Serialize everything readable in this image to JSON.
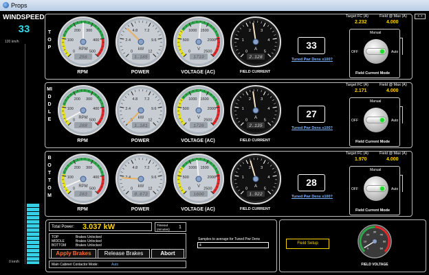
{
  "window": {
    "title": "Props"
  },
  "windspeed": {
    "label": "WINDSPEED",
    "value": "33",
    "scale_max": "120 km/h",
    "scale_min": "0 km/h",
    "bar_fraction": 0.275
  },
  "corner_button": "< >",
  "rows": [
    {
      "name": "TOP",
      "gauges": {
        "rpm": {
          "label": "RPM",
          "unit": "RPM",
          "readout": "256",
          "needle_fraction": 0.5
        },
        "power": {
          "label": "POWER",
          "unit": "kW",
          "readout": "1.185",
          "needle_fraction": 0.33
        },
        "voltage": {
          "label": "VOLTAGE (AC)",
          "unit": "V",
          "readout": "1719",
          "needle_fraction": 0.52
        },
        "current": {
          "label": "FIELD CURRENT",
          "unit": "A",
          "readout": "2.128",
          "needle_fraction": 0.47
        }
      },
      "tuned_value": "33",
      "tuned_label": "Tuned Pwr Dens x100?",
      "target_label": "Target FC (A)",
      "target_value": "2.232",
      "field_label": "Field @ Max (A)",
      "field_value": "4.000",
      "mode": {
        "manual": "Manual",
        "off": "OFF",
        "auto": "Auto",
        "caption": "Field Current Mode"
      }
    },
    {
      "name": "MIDDLE",
      "gauges": {
        "rpm": {
          "label": "RPM",
          "unit": "RPM",
          "readout": "288",
          "needle_fraction": 0.06
        },
        "power": {
          "label": "POWER",
          "unit": "kW",
          "readout": "1.181",
          "needle_fraction": 0.0
        },
        "voltage": {
          "label": "VOLTAGE (AC)",
          "unit": "V",
          "readout": "1726",
          "needle_fraction": 0.52
        },
        "current": {
          "label": "FIELD CURRENT",
          "unit": "A",
          "readout": "2.135",
          "needle_fraction": 0.47
        }
      },
      "tuned_value": "27",
      "tuned_label": "Tuned Pwr Dens x100?",
      "target_label": "Target FC (A)",
      "target_value": "2.171",
      "field_label": "Field @ Max (A)",
      "field_value": "4.000",
      "mode": {
        "manual": "Manual",
        "off": "OFF",
        "auto": "Auto",
        "caption": "Field Current Mode"
      }
    },
    {
      "name": "BOTTOM",
      "gauges": {
        "rpm": {
          "label": "RPM",
          "unit": "RPM",
          "readout": "283",
          "needle_fraction": 0.08
        },
        "power": {
          "label": "POWER",
          "unit": "kW",
          "readout": "0.673",
          "needle_fraction": 0.18
        },
        "voltage": {
          "label": "VOLTAGE (AC)",
          "unit": "V",
          "readout": "1600",
          "needle_fraction": 0.48
        },
        "current": {
          "label": "FIELD CURRENT",
          "unit": "A",
          "readout": "1.922",
          "needle_fraction": 0.44
        }
      },
      "tuned_value": "28",
      "tuned_label": "Tuned Pwr Dens x100?",
      "target_label": "Target FC (A)",
      "target_value": "1.970",
      "field_label": "Field @ Max (A)",
      "field_value": "4.000",
      "mode": {
        "manual": "Manual",
        "off": "OFF",
        "auto": "Auto",
        "caption": "Field Current Mode"
      }
    }
  ],
  "scales": {
    "rpm": [
      "0",
      "100",
      "200",
      "300",
      "400",
      "500"
    ],
    "power": [
      "0",
      "2.4",
      "4.8",
      "7.2",
      "9.6",
      "12"
    ],
    "voltage": [
      "0",
      "500",
      "1000",
      "1500",
      "2000",
      "2500"
    ],
    "current": [
      "0",
      "1",
      "2",
      "3",
      "4",
      "5"
    ]
  },
  "bottom": {
    "total_power_label": "Total Power:",
    "total_power_value": "3.037 kW",
    "timeout_label": "Timeout (minutes)",
    "timeout_value": "1",
    "brake_rows": [
      {
        "name": "TOP",
        "status": "Brakes Unlocked"
      },
      {
        "name": "MIDDLE",
        "status": "Brakes Unlocked"
      },
      {
        "name": "BOTTOM",
        "status": "Brakes Unlocked"
      }
    ],
    "apply_brakes": "Apply Brakes",
    "release_brakes": "Release Brakes",
    "abort": "Abort",
    "contactor_label": "Main Cabinet Contactor Mode:",
    "contactor_value": "Auto",
    "samples_label": "Samples to average for Tuned Pwr Dens",
    "samples_value": "4",
    "field_setup": "Field Setup",
    "field_voltage_label": "FIELD VOLTAGE",
    "field_voltage_scale": [
      "0",
      "10",
      "20",
      "30",
      "40",
      "50",
      "60"
    ],
    "field_voltage_fraction": 0.05
  },
  "colors": {
    "accent_cyan": "#35d7e2",
    "value_yellow": "#ffd400",
    "brake_button": "#ff6a3a",
    "link_blue": "#7fb8ff"
  }
}
